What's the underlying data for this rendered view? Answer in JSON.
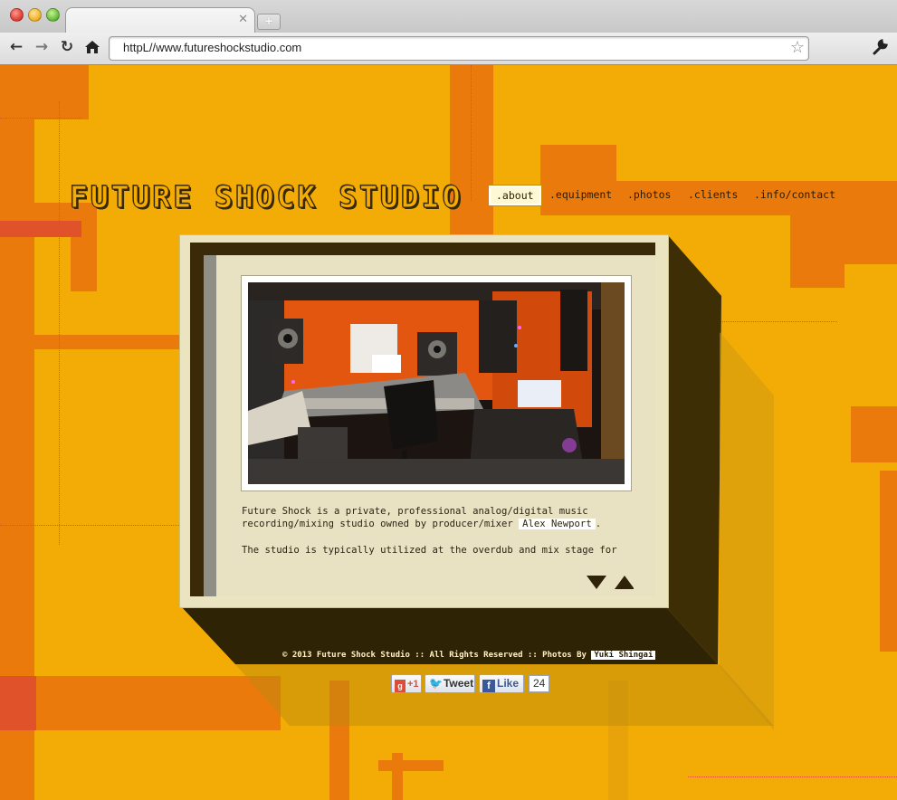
{
  "browser": {
    "url": "httpL//www.futureshockstudio.com",
    "icons": {
      "back": "back-arrow-icon",
      "forward": "forward-arrow-icon",
      "reload": "reload-icon",
      "home": "home-icon",
      "bookmark": "star-icon",
      "settings": "wrench-icon",
      "close_tab": "close-icon",
      "new_tab": "plus-icon"
    }
  },
  "site": {
    "logo": "FUTURE SHOCK STUDIO",
    "nav": [
      ".about",
      ".equipment",
      ".photos",
      ".clients",
      ".info/contact"
    ],
    "active_nav": ".about",
    "intro_text": "Future Shock is a private, professional analog/digital music recording/mixing studio owned by producer/mixer ",
    "intro_link": "Alex Newport",
    "intro_end": ".",
    "second_text": "The studio is typically utilized at the overdub and mix stage for",
    "footer_text": "© 2013 Future Shock Studio  ::  All Rights Reserved  ::  Photos By ",
    "footer_credit": "Yuki Shingai",
    "social": {
      "gplus": "+1",
      "tweet": "Tweet",
      "like": "Like",
      "like_count": "24"
    }
  },
  "colors": {
    "background": "#f3ab05",
    "accent_orange": "#eb7a0d",
    "deep_orange": "#e0522a",
    "panel": "#e8e1c2",
    "dark_frame": "#3a2a08"
  }
}
